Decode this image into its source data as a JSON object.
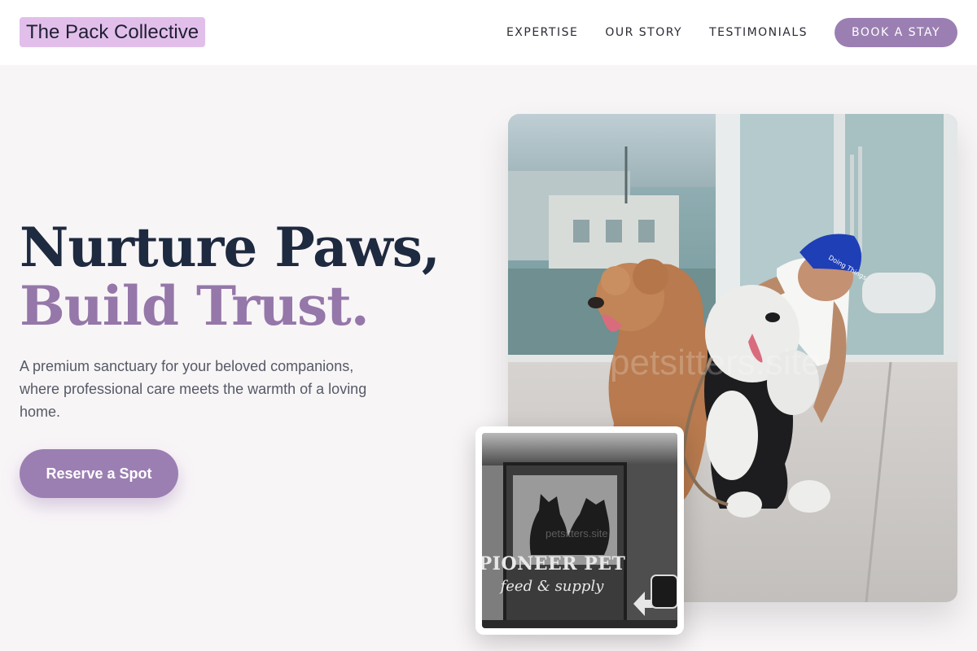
{
  "header": {
    "logo": "The Pack Collective",
    "nav": [
      "EXPERTISE",
      "OUR STORY",
      "TESTIMONIALS"
    ],
    "cta": "BOOK A STAY"
  },
  "hero": {
    "headline_line1": "Nurture Paws,",
    "headline_line2": "Build Trust.",
    "description": "A premium sanctuary for your beloved companions, where professional care meets the warmth of a loving home.",
    "button": "Reserve a Spot"
  },
  "images": {
    "main_watermark": "petsitters.site",
    "cap_text": "Doing Things",
    "thumb_sign_line1": "PIONEER PET",
    "thumb_sign_line2": "feed & supply",
    "thumb_watermark": "petsitters.site"
  },
  "colors": {
    "accent": "#9b7fb2",
    "logo_bg": "#e2bfea",
    "headline_dark": "#1e2a3f",
    "headline_accent": "#9577a9",
    "background": "#f8f5f7"
  }
}
